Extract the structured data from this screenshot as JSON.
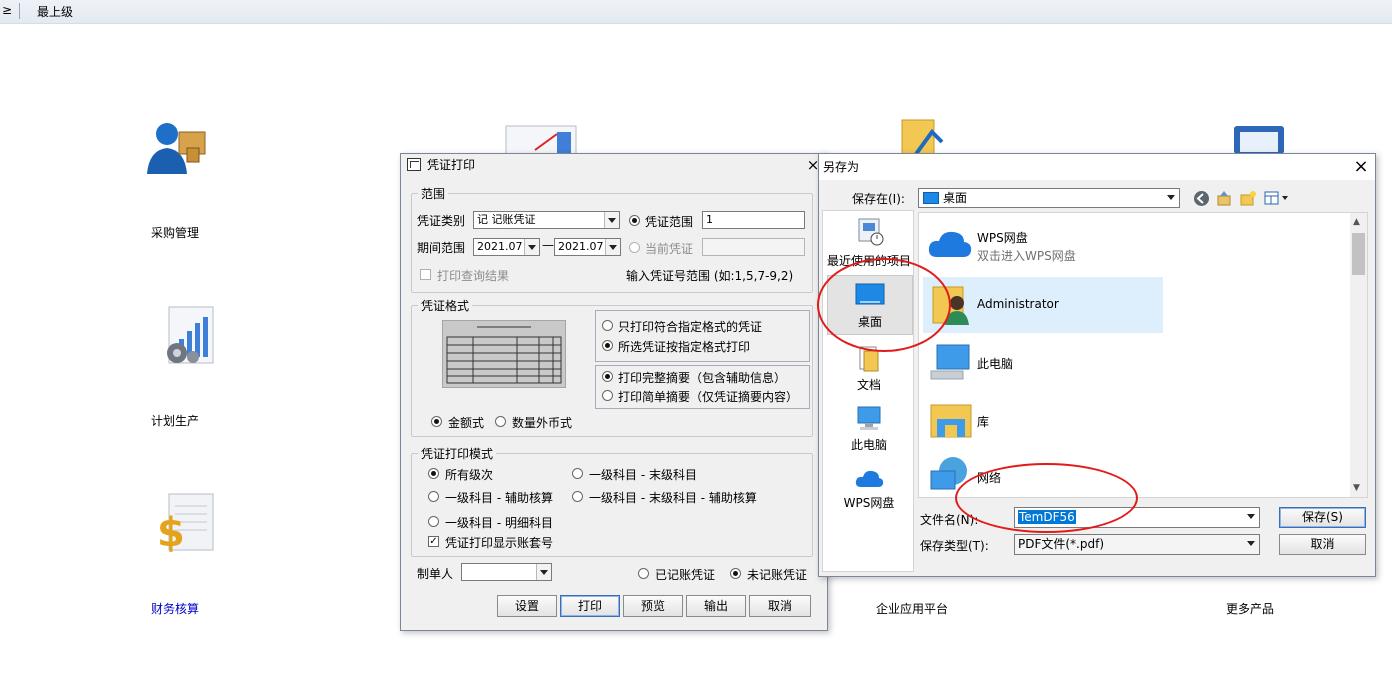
{
  "topbar": {
    "edge_glyph": "≥",
    "crumb": "最上级"
  },
  "desktop": {
    "items": [
      {
        "label": "采购管理",
        "icon": "purchase-icon"
      },
      {
        "label": "计划生产",
        "icon": "production-plan-icon"
      },
      {
        "label": "财务核算",
        "icon": "finance-icon"
      },
      {
        "label": "企业应用平台",
        "icon": "platform-icon"
      },
      {
        "label": "更多产品",
        "icon": "more-products-icon"
      }
    ],
    "finance_label_color": "#0000cc"
  },
  "print_dialog": {
    "title": "凭证打印",
    "close": "×",
    "scope": {
      "legend": "范围",
      "category_label": "凭证类别",
      "category_value": "记 记账凭证",
      "range_radio": "凭证范围",
      "range_value": "1",
      "period_label": "期间范围",
      "period_from": "2021.07",
      "period_to": "2021.07",
      "period_dash": "—",
      "current_radio": "当前凭证",
      "print_query": "打印查询结果",
      "range_hint": "输入凭证号范围 (如:1,5,7-9,2)"
    },
    "format": {
      "legend": "凭证格式",
      "opt_only": "只打印符合指定格式的凭证",
      "opt_all": "所选凭证按指定格式打印",
      "opt_full": "打印完整摘要（包含辅助信息）",
      "opt_simple": "打印简单摘要（仅凭证摘要内容）",
      "amount": "金额式",
      "quantity": "数量外币式"
    },
    "mode": {
      "legend": "凭证打印模式",
      "opt1": "所有级次",
      "opt2": "一级科目 - 末级科目",
      "opt3": "一级科目 - 辅助核算",
      "opt4": "一级科目 - 末级科目 - 辅助核算",
      "opt5": "一级科目 - 明细科目",
      "show_account": "凭证打印显示账套号",
      "check_mark": "✓"
    },
    "maker_label": "制单人",
    "posted": "已记账凭证",
    "unposted": "未记账凭证",
    "buttons": {
      "setup": "设置",
      "print": "打印",
      "preview": "预览",
      "output": "输出",
      "cancel": "取消"
    }
  },
  "save_dialog": {
    "title": "另存为",
    "close": "×",
    "save_in_label": "保存在(I):",
    "save_in_value": "桌面",
    "sidebar": [
      {
        "label": "最近使用的项目",
        "icon": "recent-icon"
      },
      {
        "label": "桌面",
        "icon": "desktop-icon"
      },
      {
        "label": "文档",
        "icon": "documents-icon"
      },
      {
        "label": "此电脑",
        "icon": "this-pc-icon"
      },
      {
        "label": "WPS网盘",
        "icon": "wps-cloud-icon"
      }
    ],
    "list": [
      {
        "name": "WPS网盘",
        "sub": "双击进入WPS网盘"
      },
      {
        "name": "Administrator",
        "sub": ""
      },
      {
        "name": "此电脑",
        "sub": ""
      },
      {
        "name": "库",
        "sub": ""
      },
      {
        "name": "网络",
        "sub": ""
      }
    ],
    "filename_label": "文件名(N):",
    "filename_value": "TemDF56",
    "filetype_label": "保存类型(T):",
    "filetype_value": "PDF文件(*.pdf)",
    "save_btn": "保存(S)",
    "cancel_btn": "取消"
  },
  "colors": {
    "annotation": "#e31a1a",
    "selection": "#ddeefc",
    "filename_highlight": "#0078d7"
  }
}
